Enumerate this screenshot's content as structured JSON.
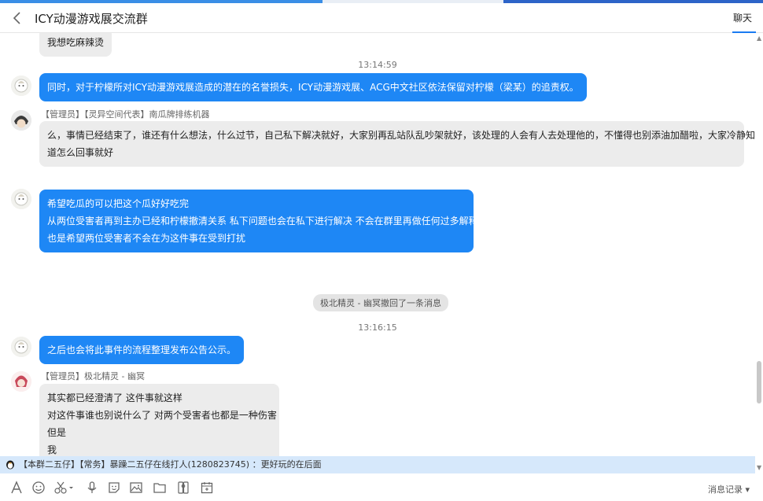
{
  "window": {
    "title": "ICY动漫游戏展交流群",
    "tab_chat": "聊天"
  },
  "messages": {
    "m0": {
      "lines": [
        "我想吃麻辣烫"
      ]
    },
    "t1": "13:14:59",
    "m1": {
      "lines": [
        "同时，对于柠檬所对ICY动漫游戏展造成的潜在的名誉损失，ICY动漫游戏展、ACG中文社区依法保留对柠檬（梁某）的追责权。"
      ]
    },
    "m2": {
      "sender": "【管理员】【灵异空间代表】南瓜牌排练机器",
      "lines": [
        "么，事情已经结束了，谁还有什么想法，什么过节，自己私下解决就好，大家别再乱站队乱吵架就好，该处理的人会有人去处理他的，不懂得也别添油加醋啦，大家冷静知",
        "道怎么回事就好"
      ]
    },
    "m3": {
      "lines": [
        "希望吃瓜的可以把这个瓜好好吃完",
        "从两位受害者再到主办已经和柠檬撤清关系  私下问题也会在私下进行解决 不会在群里再做任何过多解释",
        "也是希望两位受害者不会在为这件事在受到打扰"
      ]
    },
    "system_notice": "极北精灵 - 幽冥撤回了一条消息",
    "t2": "13:16:15",
    "m4": {
      "lines": [
        "之后也会将此事件的流程整理发布公告公示。"
      ]
    },
    "m5": {
      "sender": "【管理员】极北精灵 - 幽冥",
      "lines": [
        "其实都已经澄清了  这件事就这样",
        "对这件事谁也别说什么了  对两个受害者也都是一种伤害",
        "但是",
        "我"
      ]
    }
  },
  "ticker": {
    "text": "【本群二五仔】【常务】暴躁二五仔在线打人(1280823745) ：更好玩的在后面"
  },
  "toolbar": {
    "history_label": "消息记录"
  },
  "icons": {
    "font": "font-icon",
    "emoji": "emoji-icon",
    "screenshot": "scissors-icon",
    "voice": "microphone-icon",
    "image": "image-icon",
    "folder": "folder-icon",
    "history": "history-dropdown-icon"
  }
}
